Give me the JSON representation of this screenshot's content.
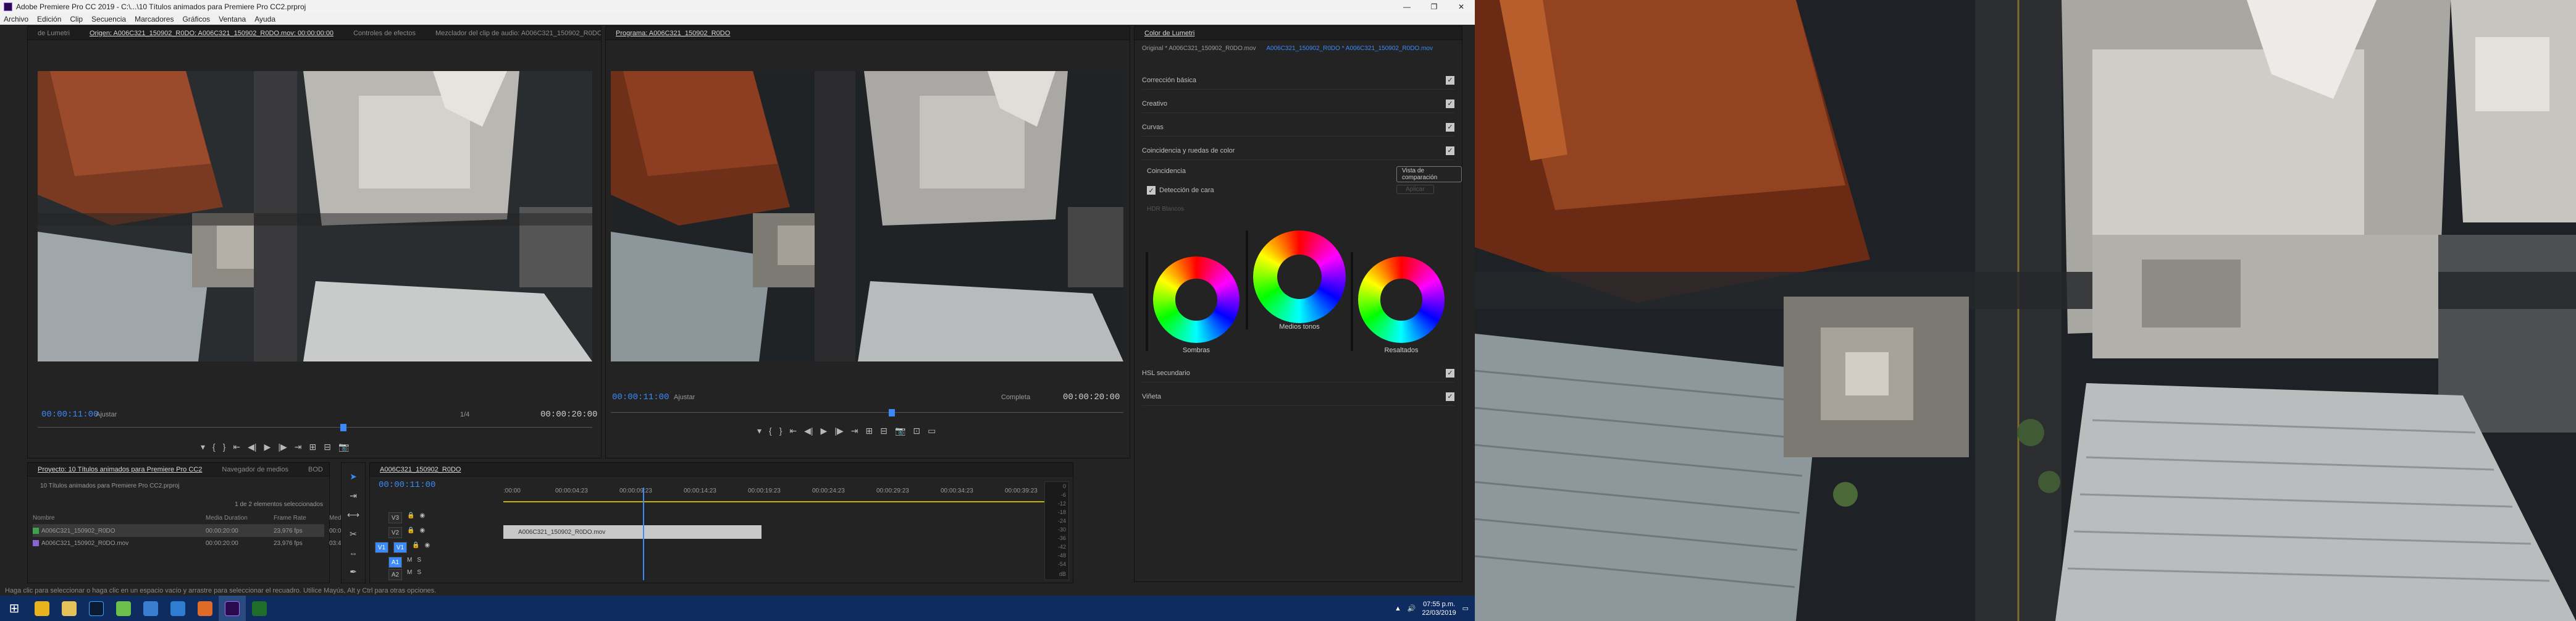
{
  "window": {
    "title": "Adobe Premiere Pro CC 2019 - C:\\...\\10 Títulos animados para Premiere Pro CC2.prproj",
    "controls": [
      "—",
      "❐",
      "✕"
    ]
  },
  "menu": [
    "Archivo",
    "Edición",
    "Clip",
    "Secuencia",
    "Marcadores",
    "Gráficos",
    "Ventana",
    "Ayuda"
  ],
  "source_panel": {
    "tabs": [
      "de Lumetri",
      "Origen: A006C321_150902_R0DO: A006C321_150902_R0DO.mov: 00:00:00:00",
      "Controles de efectos",
      "Mezclador del clip de audio: A006C321_150902_R0DO"
    ],
    "timecode": "00:00:11:00",
    "fit": "Ajustar",
    "scale": "1/4",
    "duration": "00:00:20:00",
    "controls": [
      "▾",
      "{",
      "}",
      "⇤",
      "◀|",
      "▶",
      "|▶",
      "⇥",
      "⊞",
      "⊟",
      "📷"
    ]
  },
  "program_panel": {
    "tabs": [
      "Programa: A006C321_150902_R0DO"
    ],
    "timecode": "00:00:11:00",
    "fit": "Ajustar",
    "quality": "Completa",
    "duration": "00:00:20:00",
    "controls": [
      "▾",
      "{",
      "}",
      "⇤",
      "◀|",
      "▶",
      "|▶",
      "⇥",
      "⊞",
      "⊟",
      "📷",
      "⊡",
      "▭"
    ]
  },
  "lumetri": {
    "tab": "Color de Lumetri",
    "source": "Original * A006C321_150902_R0DO.mov",
    "target": "A006C321_150902_R0DO * A006C321_150902_R0DO.mov",
    "sections": [
      "Corrección básica",
      "Creativo",
      "Curvas",
      "Coincidencia y ruedas de color"
    ],
    "match_label": "Coincidencia",
    "compare_button": "Vista de comparación",
    "face_detect": "Detección de cara",
    "apply_button": "Aplicar",
    "hdr": "HDR Blancos",
    "wheels": [
      "Sombras",
      "Medios tonos",
      "Resaltados"
    ],
    "lower_sections": [
      "HSL secundario",
      "Viñeta"
    ]
  },
  "project_panel": {
    "tabs": [
      "Proyecto: 10 Títulos animados para Premiere Pro CC2",
      "Navegador de medios",
      "BOD"
    ],
    "project_file": "10 Títulos animados para Premiere Pro CC2.prproj",
    "selection": "1 de 2 elementos seleccionados",
    "headers": [
      "Nombre",
      "",
      "Media Duration",
      "Frame Rate",
      "Media Start"
    ],
    "rows": [
      {
        "name": "A006C321_150902_R0DO",
        "duration": "00:00:20:00",
        "fps": "23,976 fps",
        "start": "00:06:04",
        "color": "#3fa34d"
      },
      {
        "name": "A006C321_150902_R0DO.mov",
        "duration": "00:00:20:00",
        "fps": "23,976 fps",
        "start": "03:47:44",
        "color": "#8a63d2"
      }
    ]
  },
  "timeline": {
    "tab": "A006C321_150902_R0DO",
    "timecode": "00:00:11:00",
    "ruler": [
      ":00:00",
      "00:00:04:23",
      "00:00:09:23",
      "00:00:14:23",
      "00:00:19:23",
      "00:00:24:23",
      "00:00:29:23",
      "00:00:34:23",
      "00:00:39:23"
    ],
    "clip": "A006C321_150902_R0DO.mov",
    "tracks": [
      "V3",
      "V2",
      "V1",
      "A1",
      "A2",
      "A3"
    ],
    "meter_labels": [
      "0",
      "-6",
      "-12",
      "-18",
      "-24",
      "-30",
      "-36",
      "-42",
      "-48",
      "-54",
      "dB"
    ]
  },
  "status": "Haga clic para seleccionar o haga clic en un espacio vacío y arrastre para seleccionar el recuadro. Utilice Mayús, Alt y Ctrl para otras opciones.",
  "taskbar": {
    "apps": [
      {
        "name": "chrome",
        "color": "#e8b21d"
      },
      {
        "name": "explorer",
        "color": "#e3c25a"
      },
      {
        "name": "photoshop",
        "color": "#0b1a33"
      },
      {
        "name": "android",
        "color": "#6cbf4a"
      },
      {
        "name": "edge",
        "color": "#3b7ed0"
      },
      {
        "name": "maps",
        "color": "#2f7dd1"
      },
      {
        "name": "firefox",
        "color": "#e06a28"
      },
      {
        "name": "premiere",
        "color": "#2a0a4a"
      },
      {
        "name": "media-encoder",
        "color": "#1e6e2a"
      }
    ],
    "time": "07:55 p.m.",
    "date": "22/03/2019"
  },
  "colors": {
    "accent": "#3b8af8",
    "panel": "#232323",
    "taskbar": "#0e2c60"
  }
}
